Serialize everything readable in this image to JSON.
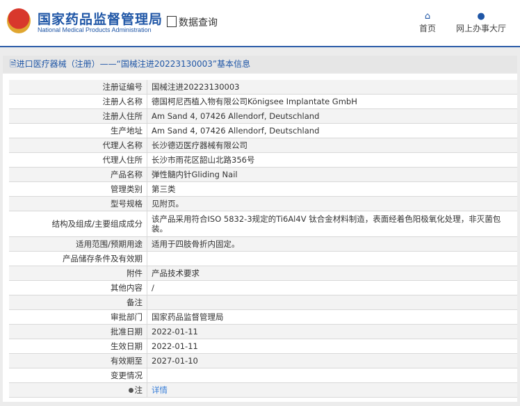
{
  "header": {
    "brand_cn": "国家药品监督管理局",
    "brand_en": "National Medical Products Administration",
    "data_query": "数据查询",
    "nav": [
      {
        "label": "首页",
        "icon": "home-icon"
      },
      {
        "label": "网上办事大厅",
        "icon": "user-icon"
      }
    ]
  },
  "title": "进口医疗器械（注册）——“国械注进20223130003”基本信息",
  "rows": [
    {
      "label": "注册证编号",
      "value": "国械注进20223130003"
    },
    {
      "label": "注册人名称",
      "value": "德国柯尼西植入物有限公司Königsee Implantate GmbH"
    },
    {
      "label": "注册人住所",
      "value": "Am Sand 4, 07426 Allendorf, Deutschland"
    },
    {
      "label": "生产地址",
      "value": "Am Sand 4, 07426 Allendorf, Deutschland"
    },
    {
      "label": "代理人名称",
      "value": "长沙德迈医疗器械有限公司"
    },
    {
      "label": "代理人住所",
      "value": "长沙市雨花区韶山北路356号"
    },
    {
      "label": "产品名称",
      "value": "弹性髓内针Gliding Nail"
    },
    {
      "label": "管理类别",
      "value": "第三类"
    },
    {
      "label": "型号规格",
      "value": "见附页。"
    },
    {
      "label": "结构及组成/主要组成成分",
      "value": "该产品采用符合ISO 5832-3规定的Ti6Al4V 钛合金材料制造，表面经着色阳极氧化处理，非灭菌包装。"
    },
    {
      "label": "适用范围/预期用途",
      "value": "适用于四肢骨折内固定。"
    },
    {
      "label": "产品储存条件及有效期",
      "value": ""
    },
    {
      "label": "附件",
      "value": "产品技术要求"
    },
    {
      "label": "其他内容",
      "value": "/"
    },
    {
      "label": "备注",
      "value": ""
    },
    {
      "label": "审批部门",
      "value": "国家药品监督管理局"
    },
    {
      "label": "批准日期",
      "value": "2022-01-11"
    },
    {
      "label": "生效日期",
      "value": "2022-01-11"
    },
    {
      "label": "有效期至",
      "value": "2027-01-10"
    },
    {
      "label": "变更情况",
      "value": ""
    }
  ],
  "note": {
    "label": "注",
    "link": "详情"
  }
}
